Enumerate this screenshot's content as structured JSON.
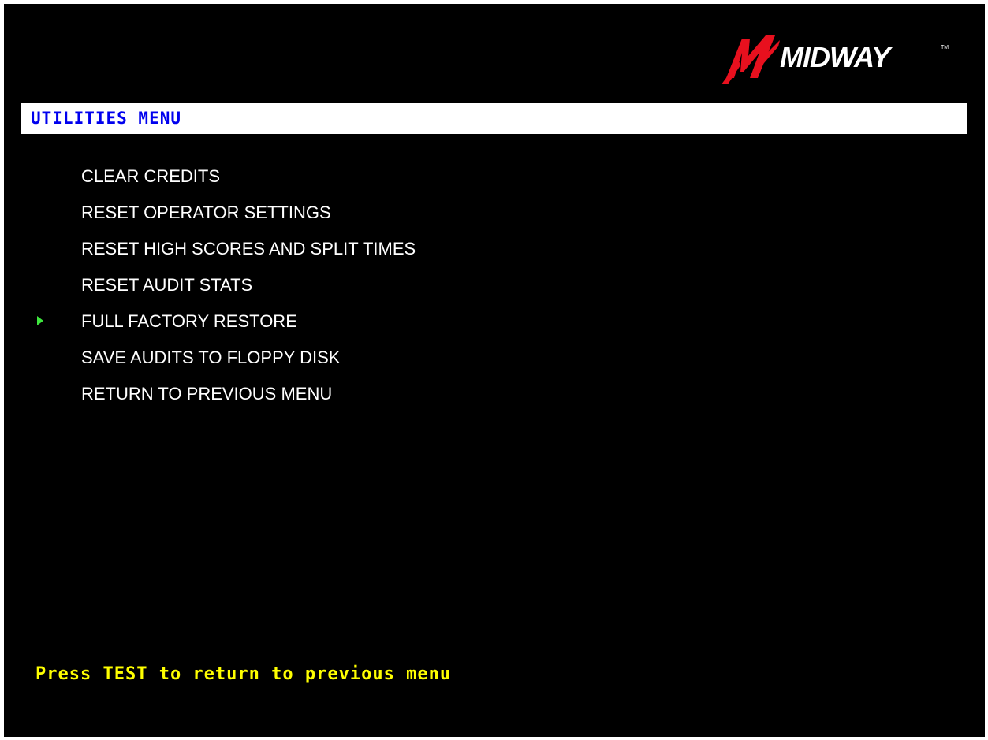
{
  "brand": {
    "logo_text": "MIDWAY",
    "logo_tm": "TM",
    "accent_color": "#e8101e"
  },
  "header": {
    "title": "UTILITIES MENU",
    "title_color": "#0000ee"
  },
  "menu": {
    "selected_index": 4,
    "cursor_color": "#3ee63e",
    "items": [
      {
        "label": "CLEAR CREDITS"
      },
      {
        "label": "RESET OPERATOR SETTINGS"
      },
      {
        "label": "RESET HIGH SCORES AND SPLIT TIMES"
      },
      {
        "label": "RESET AUDIT STATS"
      },
      {
        "label": "FULL FACTORY RESTORE"
      },
      {
        "label": "SAVE AUDITS TO FLOPPY DISK"
      },
      {
        "label": "RETURN TO PREVIOUS MENU"
      }
    ]
  },
  "footer": {
    "hint": "Press TEST to return to previous menu",
    "hint_color": "#ffff00"
  }
}
